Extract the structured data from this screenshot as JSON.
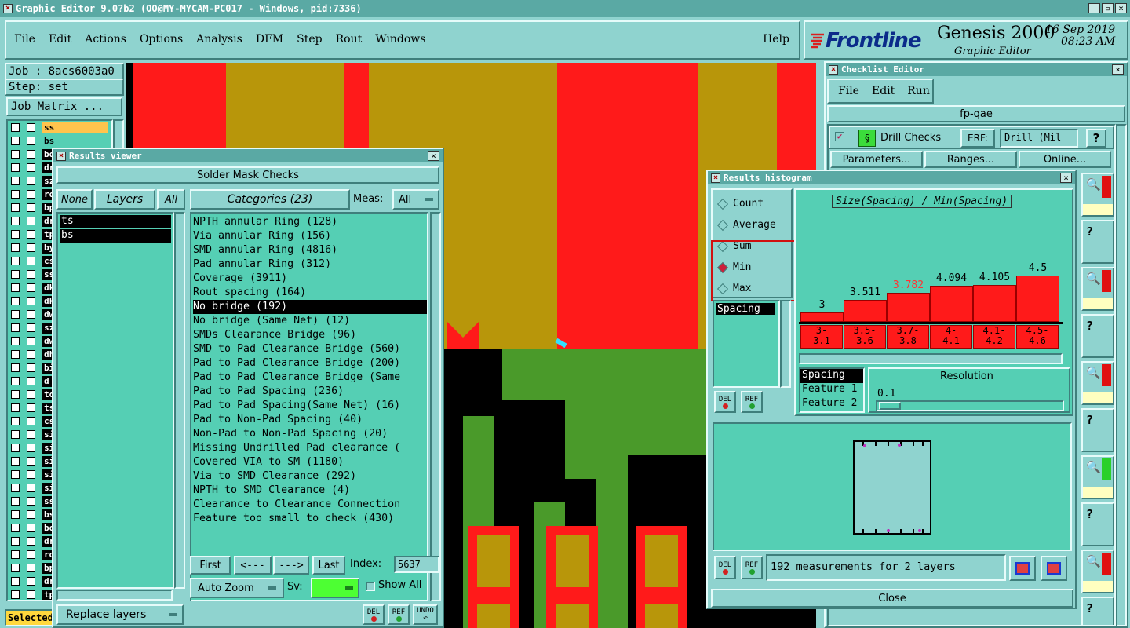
{
  "window_title": "Graphic Editor 9.0?b2 (OO@MY-MYCAM-PC017 - Windows, pid:7336)",
  "menu": [
    "File",
    "Edit",
    "Actions",
    "Options",
    "Analysis",
    "DFM",
    "Step",
    "Rout",
    "Windows"
  ],
  "help": "Help",
  "brand": {
    "logo": "Frontline",
    "product": "Genesis 2000",
    "sub": "Graphic Editor",
    "date": "16 Sep 2019",
    "time": "08:23 AM"
  },
  "left_panel": {
    "job": "Job : 8acs6003a0",
    "step": "Step: set",
    "job_matrix": "Job Matrix ...",
    "layers": [
      "ss",
      "bs",
      "bo",
      "dr",
      "sz",
      "ro",
      "bp",
      "dr",
      "tp",
      "by",
      "cs",
      "ss",
      "dk",
      "dk",
      "dw",
      "sz",
      "dw",
      "dh",
      "bi",
      "d",
      "to.",
      "ts.",
      "cs.",
      "sig",
      "sig",
      "sig",
      "sig",
      "sig",
      "ss.",
      "bs.",
      "bo.",
      "dr",
      "rou",
      "bp.",
      "dr",
      "tp."
    ],
    "selected": "Selected"
  },
  "results_viewer": {
    "title": "Results viewer",
    "header": "Solder Mask Checks",
    "none": "None",
    "layers": "Layers",
    "all": "All",
    "categories": "Categories (23)",
    "meas_label": "Meas:",
    "meas_value": "All",
    "layer_items": [
      "ts",
      "bs"
    ],
    "categories_list": [
      "NPTH annular Ring (128)",
      "Via annular Ring (156)",
      "SMD annular Ring (4816)",
      "Pad annular Ring (312)",
      "Coverage (3911)",
      "Rout spacing (164)",
      "No bridge (192)",
      "No bridge (Same Net) (12)",
      "SMDs Clearance Bridge (96)",
      "SMD to Pad Clearance Bridge (560)",
      "Pad to Pad Clearance Bridge (200)",
      "Pad to Pad Clearance Bridge (Same",
      "Pad to Pad Spacing (236)",
      "Pad to Pad Spacing(Same Net) (16)",
      "Pad to Non-Pad Spacing (40)",
      "Non-Pad to Non-Pad Spacing (20)",
      "Missing Undrilled Pad clearance (",
      "Covered VIA to SM (1180)",
      "Via to SMD Clearance (292)",
      "NPTH to SMD Clearance (4)",
      "Clearance to Clearance Connection",
      "Feature too small to check (430)"
    ],
    "selected_index": 6,
    "first": "First",
    "prev": "<---",
    "next": "--->",
    "last": "Last",
    "index_label": "Index:",
    "index_value": "5637",
    "auto_zoom": "Auto Zoom",
    "sv": "Sv:",
    "show_all": "Show All",
    "replace_layers": "Replace layers",
    "del": "DEL",
    "ref": "REF",
    "undo": "UNDO"
  },
  "checklist_editor": {
    "title": "Checklist Editor",
    "menu": [
      "File",
      "Edit",
      "Run"
    ],
    "name": "fp-qae",
    "drill_checks": "Drill Checks",
    "erf": "ERF:",
    "erf_value": "Drill (Mil",
    "parameters": "Parameters...",
    "ranges": "Ranges...",
    "online": "Online..."
  },
  "histogram": {
    "title": "Results histogram",
    "options": [
      "Count",
      "Average",
      "Sum",
      "Min",
      "Max"
    ],
    "selected": "Min",
    "spacing_item": "Spacing",
    "chart_title": "Size(Spacing) / Min(Spacing)",
    "bars": [
      {
        "label": "3",
        "range": "3-\n3.1",
        "value": 3
      },
      {
        "label": "3.511",
        "range": "3.5-\n3.6",
        "value": 3.511
      },
      {
        "label": "3.782",
        "range": "3.7-\n3.8",
        "value": 3.782
      },
      {
        "label": "4.094",
        "range": "4-\n4.1",
        "value": 4.094
      },
      {
        "label": "4.105",
        "range": "4.1-\n4.2",
        "value": 4.105
      },
      {
        "label": "4.5",
        "range": "4.5-\n4.6",
        "value": 4.5
      }
    ],
    "highlight_color": "#ff3333",
    "measure_list": [
      "Spacing",
      "Feature 1",
      "Feature 2"
    ],
    "resolution_label": "Resolution",
    "resolution_value": "0.1",
    "status": "192 measurements for 2 layers",
    "close": "Close",
    "del": "DEL",
    "ref": "REF"
  },
  "colors": {
    "copper": "#b8960a",
    "red": "#ff1a1a",
    "green": "#4a9a2a",
    "panel": "#8fd3cf",
    "list": "#55cfb4"
  }
}
